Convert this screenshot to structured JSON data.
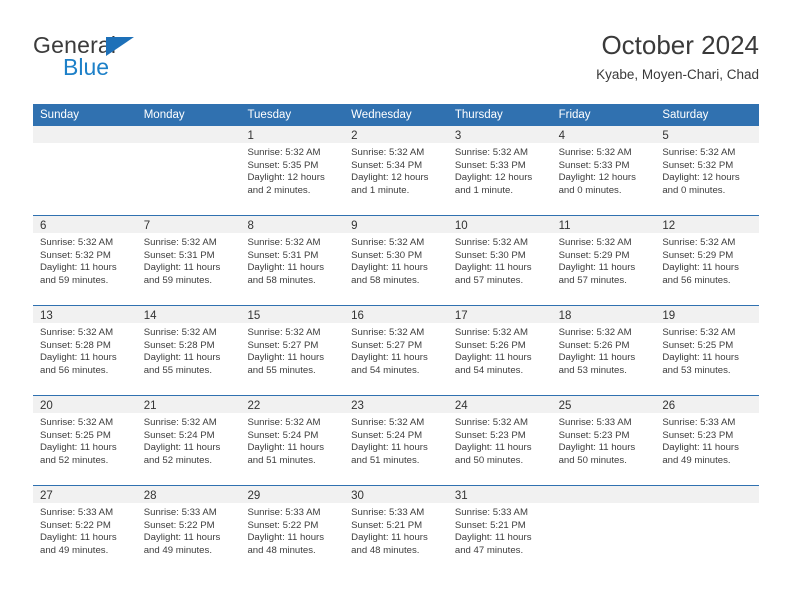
{
  "brand": {
    "word_one": "General",
    "word_two": "Blue",
    "triangle_color": "#1d70b8",
    "blue_color": "#1d80c8"
  },
  "header": {
    "title": "October 2024",
    "subtitle": "Kyabe, Moyen-Chari, Chad",
    "accent_color": "#3071b0",
    "band_color": "#f1f1f1"
  },
  "weekdays": [
    "Sunday",
    "Monday",
    "Tuesday",
    "Wednesday",
    "Thursday",
    "Friday",
    "Saturday"
  ],
  "weeks": [
    [
      {
        "day": "",
        "sunrise": "",
        "sunset": "",
        "daylight_line1": "",
        "daylight_line2": ""
      },
      {
        "day": "",
        "sunrise": "",
        "sunset": "",
        "daylight_line1": "",
        "daylight_line2": ""
      },
      {
        "day": "1",
        "sunrise": "Sunrise: 5:32 AM",
        "sunset": "Sunset: 5:35 PM",
        "daylight_line1": "Daylight: 12 hours",
        "daylight_line2": "and 2 minutes."
      },
      {
        "day": "2",
        "sunrise": "Sunrise: 5:32 AM",
        "sunset": "Sunset: 5:34 PM",
        "daylight_line1": "Daylight: 12 hours",
        "daylight_line2": "and 1 minute."
      },
      {
        "day": "3",
        "sunrise": "Sunrise: 5:32 AM",
        "sunset": "Sunset: 5:33 PM",
        "daylight_line1": "Daylight: 12 hours",
        "daylight_line2": "and 1 minute."
      },
      {
        "day": "4",
        "sunrise": "Sunrise: 5:32 AM",
        "sunset": "Sunset: 5:33 PM",
        "daylight_line1": "Daylight: 12 hours",
        "daylight_line2": "and 0 minutes."
      },
      {
        "day": "5",
        "sunrise": "Sunrise: 5:32 AM",
        "sunset": "Sunset: 5:32 PM",
        "daylight_line1": "Daylight: 12 hours",
        "daylight_line2": "and 0 minutes."
      }
    ],
    [
      {
        "day": "6",
        "sunrise": "Sunrise: 5:32 AM",
        "sunset": "Sunset: 5:32 PM",
        "daylight_line1": "Daylight: 11 hours",
        "daylight_line2": "and 59 minutes."
      },
      {
        "day": "7",
        "sunrise": "Sunrise: 5:32 AM",
        "sunset": "Sunset: 5:31 PM",
        "daylight_line1": "Daylight: 11 hours",
        "daylight_line2": "and 59 minutes."
      },
      {
        "day": "8",
        "sunrise": "Sunrise: 5:32 AM",
        "sunset": "Sunset: 5:31 PM",
        "daylight_line1": "Daylight: 11 hours",
        "daylight_line2": "and 58 minutes."
      },
      {
        "day": "9",
        "sunrise": "Sunrise: 5:32 AM",
        "sunset": "Sunset: 5:30 PM",
        "daylight_line1": "Daylight: 11 hours",
        "daylight_line2": "and 58 minutes."
      },
      {
        "day": "10",
        "sunrise": "Sunrise: 5:32 AM",
        "sunset": "Sunset: 5:30 PM",
        "daylight_line1": "Daylight: 11 hours",
        "daylight_line2": "and 57 minutes."
      },
      {
        "day": "11",
        "sunrise": "Sunrise: 5:32 AM",
        "sunset": "Sunset: 5:29 PM",
        "daylight_line1": "Daylight: 11 hours",
        "daylight_line2": "and 57 minutes."
      },
      {
        "day": "12",
        "sunrise": "Sunrise: 5:32 AM",
        "sunset": "Sunset: 5:29 PM",
        "daylight_line1": "Daylight: 11 hours",
        "daylight_line2": "and 56 minutes."
      }
    ],
    [
      {
        "day": "13",
        "sunrise": "Sunrise: 5:32 AM",
        "sunset": "Sunset: 5:28 PM",
        "daylight_line1": "Daylight: 11 hours",
        "daylight_line2": "and 56 minutes."
      },
      {
        "day": "14",
        "sunrise": "Sunrise: 5:32 AM",
        "sunset": "Sunset: 5:28 PM",
        "daylight_line1": "Daylight: 11 hours",
        "daylight_line2": "and 55 minutes."
      },
      {
        "day": "15",
        "sunrise": "Sunrise: 5:32 AM",
        "sunset": "Sunset: 5:27 PM",
        "daylight_line1": "Daylight: 11 hours",
        "daylight_line2": "and 55 minutes."
      },
      {
        "day": "16",
        "sunrise": "Sunrise: 5:32 AM",
        "sunset": "Sunset: 5:27 PM",
        "daylight_line1": "Daylight: 11 hours",
        "daylight_line2": "and 54 minutes."
      },
      {
        "day": "17",
        "sunrise": "Sunrise: 5:32 AM",
        "sunset": "Sunset: 5:26 PM",
        "daylight_line1": "Daylight: 11 hours",
        "daylight_line2": "and 54 minutes."
      },
      {
        "day": "18",
        "sunrise": "Sunrise: 5:32 AM",
        "sunset": "Sunset: 5:26 PM",
        "daylight_line1": "Daylight: 11 hours",
        "daylight_line2": "and 53 minutes."
      },
      {
        "day": "19",
        "sunrise": "Sunrise: 5:32 AM",
        "sunset": "Sunset: 5:25 PM",
        "daylight_line1": "Daylight: 11 hours",
        "daylight_line2": "and 53 minutes."
      }
    ],
    [
      {
        "day": "20",
        "sunrise": "Sunrise: 5:32 AM",
        "sunset": "Sunset: 5:25 PM",
        "daylight_line1": "Daylight: 11 hours",
        "daylight_line2": "and 52 minutes."
      },
      {
        "day": "21",
        "sunrise": "Sunrise: 5:32 AM",
        "sunset": "Sunset: 5:24 PM",
        "daylight_line1": "Daylight: 11 hours",
        "daylight_line2": "and 52 minutes."
      },
      {
        "day": "22",
        "sunrise": "Sunrise: 5:32 AM",
        "sunset": "Sunset: 5:24 PM",
        "daylight_line1": "Daylight: 11 hours",
        "daylight_line2": "and 51 minutes."
      },
      {
        "day": "23",
        "sunrise": "Sunrise: 5:32 AM",
        "sunset": "Sunset: 5:24 PM",
        "daylight_line1": "Daylight: 11 hours",
        "daylight_line2": "and 51 minutes."
      },
      {
        "day": "24",
        "sunrise": "Sunrise: 5:32 AM",
        "sunset": "Sunset: 5:23 PM",
        "daylight_line1": "Daylight: 11 hours",
        "daylight_line2": "and 50 minutes."
      },
      {
        "day": "25",
        "sunrise": "Sunrise: 5:33 AM",
        "sunset": "Sunset: 5:23 PM",
        "daylight_line1": "Daylight: 11 hours",
        "daylight_line2": "and 50 minutes."
      },
      {
        "day": "26",
        "sunrise": "Sunrise: 5:33 AM",
        "sunset": "Sunset: 5:23 PM",
        "daylight_line1": "Daylight: 11 hours",
        "daylight_line2": "and 49 minutes."
      }
    ],
    [
      {
        "day": "27",
        "sunrise": "Sunrise: 5:33 AM",
        "sunset": "Sunset: 5:22 PM",
        "daylight_line1": "Daylight: 11 hours",
        "daylight_line2": "and 49 minutes."
      },
      {
        "day": "28",
        "sunrise": "Sunrise: 5:33 AM",
        "sunset": "Sunset: 5:22 PM",
        "daylight_line1": "Daylight: 11 hours",
        "daylight_line2": "and 49 minutes."
      },
      {
        "day": "29",
        "sunrise": "Sunrise: 5:33 AM",
        "sunset": "Sunset: 5:22 PM",
        "daylight_line1": "Daylight: 11 hours",
        "daylight_line2": "and 48 minutes."
      },
      {
        "day": "30",
        "sunrise": "Sunrise: 5:33 AM",
        "sunset": "Sunset: 5:21 PM",
        "daylight_line1": "Daylight: 11 hours",
        "daylight_line2": "and 48 minutes."
      },
      {
        "day": "31",
        "sunrise": "Sunrise: 5:33 AM",
        "sunset": "Sunset: 5:21 PM",
        "daylight_line1": "Daylight: 11 hours",
        "daylight_line2": "and 47 minutes."
      },
      {
        "day": "",
        "sunrise": "",
        "sunset": "",
        "daylight_line1": "",
        "daylight_line2": ""
      },
      {
        "day": "",
        "sunrise": "",
        "sunset": "",
        "daylight_line1": "",
        "daylight_line2": ""
      }
    ]
  ]
}
